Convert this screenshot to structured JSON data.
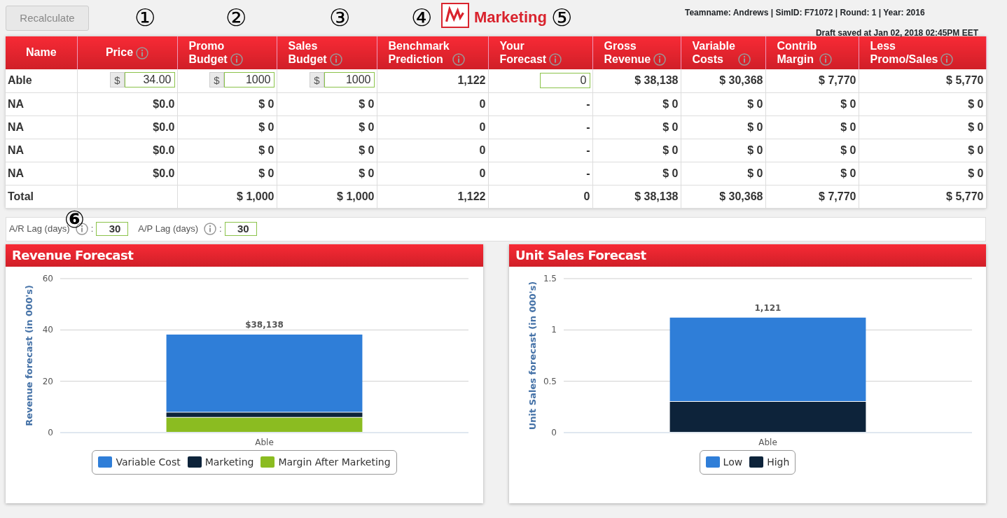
{
  "toolbar": {
    "recalculate": "Recalculate",
    "logo_text": "Marketing",
    "team_info": "Teamname: Andrews | SimID: F71072 | Round: 1 | Year: 2016",
    "draft_saved": "Draft saved at Jan 02, 2018 02:45PM EET"
  },
  "callouts": [
    "①",
    "②",
    "③",
    "④",
    "⑤",
    "⑥"
  ],
  "table": {
    "columns": [
      {
        "label": "Name",
        "info": false
      },
      {
        "label": "Price",
        "info": true
      },
      {
        "label": "Promo Budget",
        "info": true
      },
      {
        "label": "Sales Budget",
        "info": true
      },
      {
        "label": "Benchmark Prediction",
        "info": true
      },
      {
        "label": "Your Forecast",
        "info": true
      },
      {
        "label": "Gross Revenue",
        "info": true
      },
      {
        "label": "Variable Costs",
        "info": true
      },
      {
        "label": "Contrib Margin",
        "info": true
      },
      {
        "label": "Less Promo/Sales",
        "info": true
      }
    ],
    "rows": [
      [
        {
          "kind": "text",
          "text": "Able"
        },
        {
          "kind": "input",
          "prefix": "$",
          "value": "34.00"
        },
        {
          "kind": "input",
          "prefix": "$",
          "value": "1000"
        },
        {
          "kind": "input",
          "prefix": "$",
          "value": "1000"
        },
        {
          "kind": "text",
          "text": "1,122"
        },
        {
          "kind": "input",
          "value": "0"
        },
        {
          "kind": "text",
          "text": "$ 38,138"
        },
        {
          "kind": "text",
          "text": "$ 30,368"
        },
        {
          "kind": "text",
          "text": "$ 7,770"
        },
        {
          "kind": "text",
          "text": "$ 5,770"
        }
      ],
      [
        {
          "kind": "text",
          "text": "NA"
        },
        {
          "kind": "text",
          "text": "$0.0"
        },
        {
          "kind": "text",
          "text": "$ 0"
        },
        {
          "kind": "text",
          "text": "$ 0"
        },
        {
          "kind": "text",
          "text": "0"
        },
        {
          "kind": "text",
          "text": "-"
        },
        {
          "kind": "text",
          "text": "$ 0"
        },
        {
          "kind": "text",
          "text": "$ 0"
        },
        {
          "kind": "text",
          "text": "$ 0"
        },
        {
          "kind": "text",
          "text": "$ 0"
        }
      ],
      [
        {
          "kind": "text",
          "text": "NA"
        },
        {
          "kind": "text",
          "text": "$0.0"
        },
        {
          "kind": "text",
          "text": "$ 0"
        },
        {
          "kind": "text",
          "text": "$ 0"
        },
        {
          "kind": "text",
          "text": "0"
        },
        {
          "kind": "text",
          "text": "-"
        },
        {
          "kind": "text",
          "text": "$ 0"
        },
        {
          "kind": "text",
          "text": "$ 0"
        },
        {
          "kind": "text",
          "text": "$ 0"
        },
        {
          "kind": "text",
          "text": "$ 0"
        }
      ],
      [
        {
          "kind": "text",
          "text": "NA"
        },
        {
          "kind": "text",
          "text": "$0.0"
        },
        {
          "kind": "text",
          "text": "$ 0"
        },
        {
          "kind": "text",
          "text": "$ 0"
        },
        {
          "kind": "text",
          "text": "0"
        },
        {
          "kind": "text",
          "text": "-"
        },
        {
          "kind": "text",
          "text": "$ 0"
        },
        {
          "kind": "text",
          "text": "$ 0"
        },
        {
          "kind": "text",
          "text": "$ 0"
        },
        {
          "kind": "text",
          "text": "$ 0"
        }
      ],
      [
        {
          "kind": "text",
          "text": "NA"
        },
        {
          "kind": "text",
          "text": "$0.0"
        },
        {
          "kind": "text",
          "text": "$ 0"
        },
        {
          "kind": "text",
          "text": "$ 0"
        },
        {
          "kind": "text",
          "text": "0"
        },
        {
          "kind": "text",
          "text": "-"
        },
        {
          "kind": "text",
          "text": "$ 0"
        },
        {
          "kind": "text",
          "text": "$ 0"
        },
        {
          "kind": "text",
          "text": "$ 0"
        },
        {
          "kind": "text",
          "text": "$ 0"
        }
      ],
      [
        {
          "kind": "text",
          "text": "Total"
        },
        {
          "kind": "blank"
        },
        {
          "kind": "text",
          "text": "$ 1,000"
        },
        {
          "kind": "text",
          "text": "$ 1,000"
        },
        {
          "kind": "text",
          "text": "1,122"
        },
        {
          "kind": "text",
          "text": "0"
        },
        {
          "kind": "text",
          "text": "$ 38,138"
        },
        {
          "kind": "text",
          "text": "$ 30,368"
        },
        {
          "kind": "text",
          "text": "$ 7,770"
        },
        {
          "kind": "text",
          "text": "$ 5,770"
        }
      ]
    ]
  },
  "lags": [
    {
      "label": "A/R Lag (days)",
      "separator": ":",
      "value": "30"
    },
    {
      "label": "A/P Lag (days)",
      "separator": ":",
      "value": "30"
    }
  ],
  "charts": [
    {
      "title": "Revenue Forecast",
      "chart_data": {
        "type": "bar",
        "stacked": true,
        "ylabel": "Revenue forecast (in 000's)",
        "categories": [
          "Able"
        ],
        "ylim": [
          0,
          60
        ],
        "yticks": [
          0,
          20,
          40,
          60
        ],
        "value_labels": [
          "$38,138"
        ],
        "legend": true,
        "series": [
          {
            "name": "Variable Cost",
            "color": "#2f7ed8",
            "values": [
              30.4
            ]
          },
          {
            "name": "Marketing",
            "color": "#0d233a",
            "values": [
              2.0
            ]
          },
          {
            "name": "Margin After Marketing",
            "color": "#8bbc21",
            "values": [
              5.8
            ]
          }
        ]
      }
    },
    {
      "title": "Unit Sales Forecast",
      "chart_data": {
        "type": "bar",
        "stacked": true,
        "ylabel": "Unit Sales forecast (in 000's)",
        "categories": [
          "Able"
        ],
        "ylim": [
          0,
          1.5
        ],
        "yticks": [
          0,
          0.5,
          1,
          1.5
        ],
        "value_labels": [
          "1,121"
        ],
        "legend": true,
        "series": [
          {
            "name": "Low",
            "color": "#2f7ed8",
            "values": [
              0.82
            ]
          },
          {
            "name": "High",
            "color": "#0d233a",
            "values": [
              0.3
            ]
          }
        ]
      }
    }
  ]
}
